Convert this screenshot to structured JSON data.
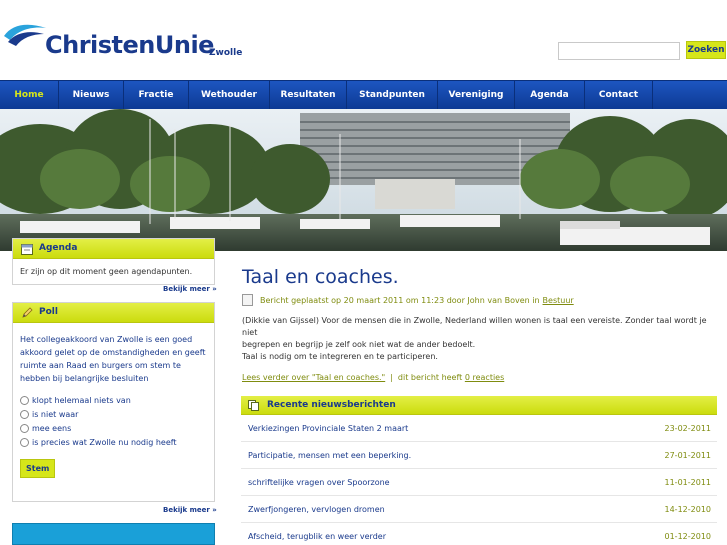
{
  "header": {
    "brand": "ChristenUnie",
    "city": "Zwolle",
    "search_placeholder": "",
    "search_button": "Zoeken"
  },
  "nav": {
    "items": [
      {
        "label": "Home"
      },
      {
        "label": "Nieuws"
      },
      {
        "label": "Fractie"
      },
      {
        "label": "Wethouder"
      },
      {
        "label": "Resultaten"
      },
      {
        "label": "Standpunten"
      },
      {
        "label": "Vereniging"
      },
      {
        "label": "Agenda"
      },
      {
        "label": "Contact"
      }
    ],
    "active": "Home"
  },
  "sidebar": {
    "agenda": {
      "title": "Agenda",
      "text": "Er zijn op dit moment geen agendapunten.",
      "more": "Bekijk meer »"
    },
    "poll": {
      "title": "Poll",
      "question": "Het collegeakkoord van Zwolle is een goed akkoord gelet op de omstandigheden en geeft ruimte aan Raad en burgers om stem te hebben bij belangrijke besluiten",
      "options": [
        {
          "label": "klopt helemaal niets van"
        },
        {
          "label": "is niet waar"
        },
        {
          "label": "mee eens"
        },
        {
          "label": "is precies wat Zwolle nu nodig heeft"
        }
      ],
      "submit": "Stem",
      "more": "Bekijk meer »"
    }
  },
  "post": {
    "title": "Taal en coaches.",
    "meta_prefix": "Bericht geplaatst op 20 maart 2011 om 11:23 door John van Boven in",
    "category": "Bestuur",
    "body_lines": [
      "(Dikkie van Gijssel) Voor de mensen die in Zwolle, Nederland willen wonen is taal een vereiste. Zonder taal wordt je niet",
      "begrepen en begrijp je zelf ook niet wat de ander bedoelt.",
      "Taal is nodig om te integreren en te participeren."
    ],
    "read_more": "Lees verder over \"Taal en coaches.\"",
    "separator": "|",
    "reactions_prefix": "dit bericht heeft",
    "reactions_link": "0 reacties"
  },
  "news": {
    "title": "Recente nieuwsberichten",
    "items": [
      {
        "title": "Verkiezingen Provinciale Staten 2 maart",
        "date": "23-02-2011"
      },
      {
        "title": "Participatie, mensen met een beperking.",
        "date": "27-01-2011"
      },
      {
        "title": "schriftelijke vragen over Spoorzone",
        "date": "11-01-2011"
      },
      {
        "title": "Zwerfjongeren, vervlogen dromen",
        "date": "14-12-2010"
      },
      {
        "title": "Afscheid, terugblik en weer verder",
        "date": "01-12-2010"
      }
    ]
  },
  "colors": {
    "brand_blue": "#1a3a8c",
    "accent_lime": "#d6e61a",
    "nav_blue": "#1d56c0",
    "meta_olive": "#7f8c0f"
  }
}
